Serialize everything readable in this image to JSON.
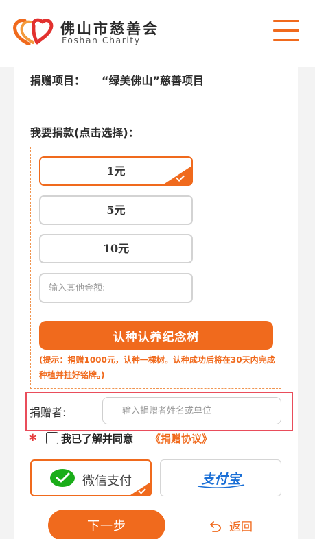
{
  "header": {
    "brand_cn": "佛山市慈善会",
    "brand_en": "Foshan Charity",
    "logo_icon": "hearts-logo-icon",
    "menu_icon": "hamburger-menu-icon"
  },
  "project": {
    "label": "捐赠项目：",
    "value": "“绿美佛山”慈善项目"
  },
  "donation": {
    "choose_label": "我要捐款(点击选择)：",
    "amounts": [
      "1元",
      "5元",
      "10元"
    ],
    "selected": "1元",
    "other_placeholder": "输入其他金额:",
    "tree_button": "认种认养纪念树",
    "tip": "(提示：捐赠1000元，认种一棵树。认种成功后将在30天内完成种植并挂好铭牌。)"
  },
  "donor": {
    "label": "捐赠者:",
    "placeholder": "输入捐赠者姓名或单位"
  },
  "agreement": {
    "required_mark": "*",
    "text": "我已了解并同意",
    "link": "《捐赠协议》"
  },
  "payment": {
    "wechat_label": "微信支付",
    "wechat_icon": "wechat-pay-icon",
    "alipay_label": "支付宝",
    "alipay_icon": "alipay-icon",
    "selected": "wechat"
  },
  "actions": {
    "next": "下一步",
    "back": "返回",
    "back_icon": "return-arrow-icon"
  },
  "colors": {
    "accent": "#f06a1d",
    "highlight_border": "#e94d5b",
    "wechat_green": "#1aad19",
    "alipay_blue": "#1677ff"
  }
}
